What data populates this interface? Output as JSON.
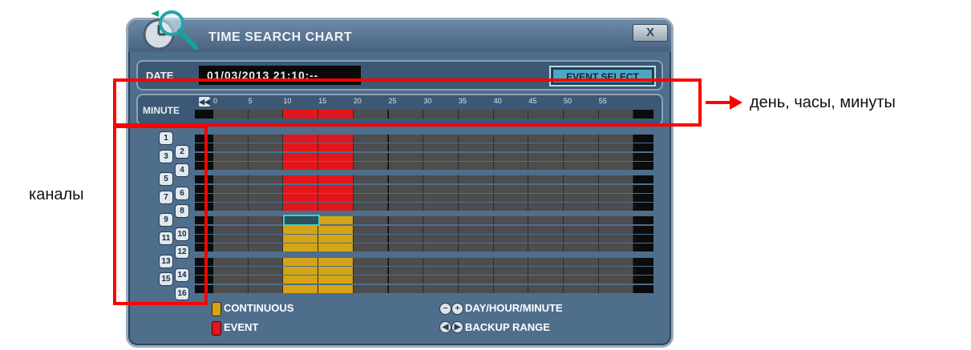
{
  "window": {
    "title": "TIME SEARCH CHART",
    "close_label": "X"
  },
  "date": {
    "label": "DATE",
    "value": "01/03/2013 21:10:--"
  },
  "event_select": {
    "label": "EVENT SELECT"
  },
  "minute": {
    "label": "MINUTE",
    "back_icon": "rewind-icon",
    "ticks": [
      "0",
      "5",
      "10",
      "15",
      "20",
      "25",
      "30",
      "35",
      "40",
      "45",
      "50",
      "55"
    ]
  },
  "channels": [
    "1",
    "2",
    "3",
    "4",
    "5",
    "6",
    "7",
    "8",
    "9",
    "10",
    "11",
    "12",
    "13",
    "14",
    "15",
    "16"
  ],
  "chart_colors": {
    "continuous": "#d4a417",
    "event": "#e3171b",
    "empty": "#4d4d4d",
    "selection": "#3ad3c8"
  },
  "legend": {
    "continuous": "CONTINUOUS",
    "event": "EVENT",
    "zoom": "DAY/HOUR/MINUTE",
    "backup": "BACKUP RANGE"
  },
  "annotations": {
    "minute_caption": "день, часы, минуты",
    "channels_caption": "каналы"
  }
}
